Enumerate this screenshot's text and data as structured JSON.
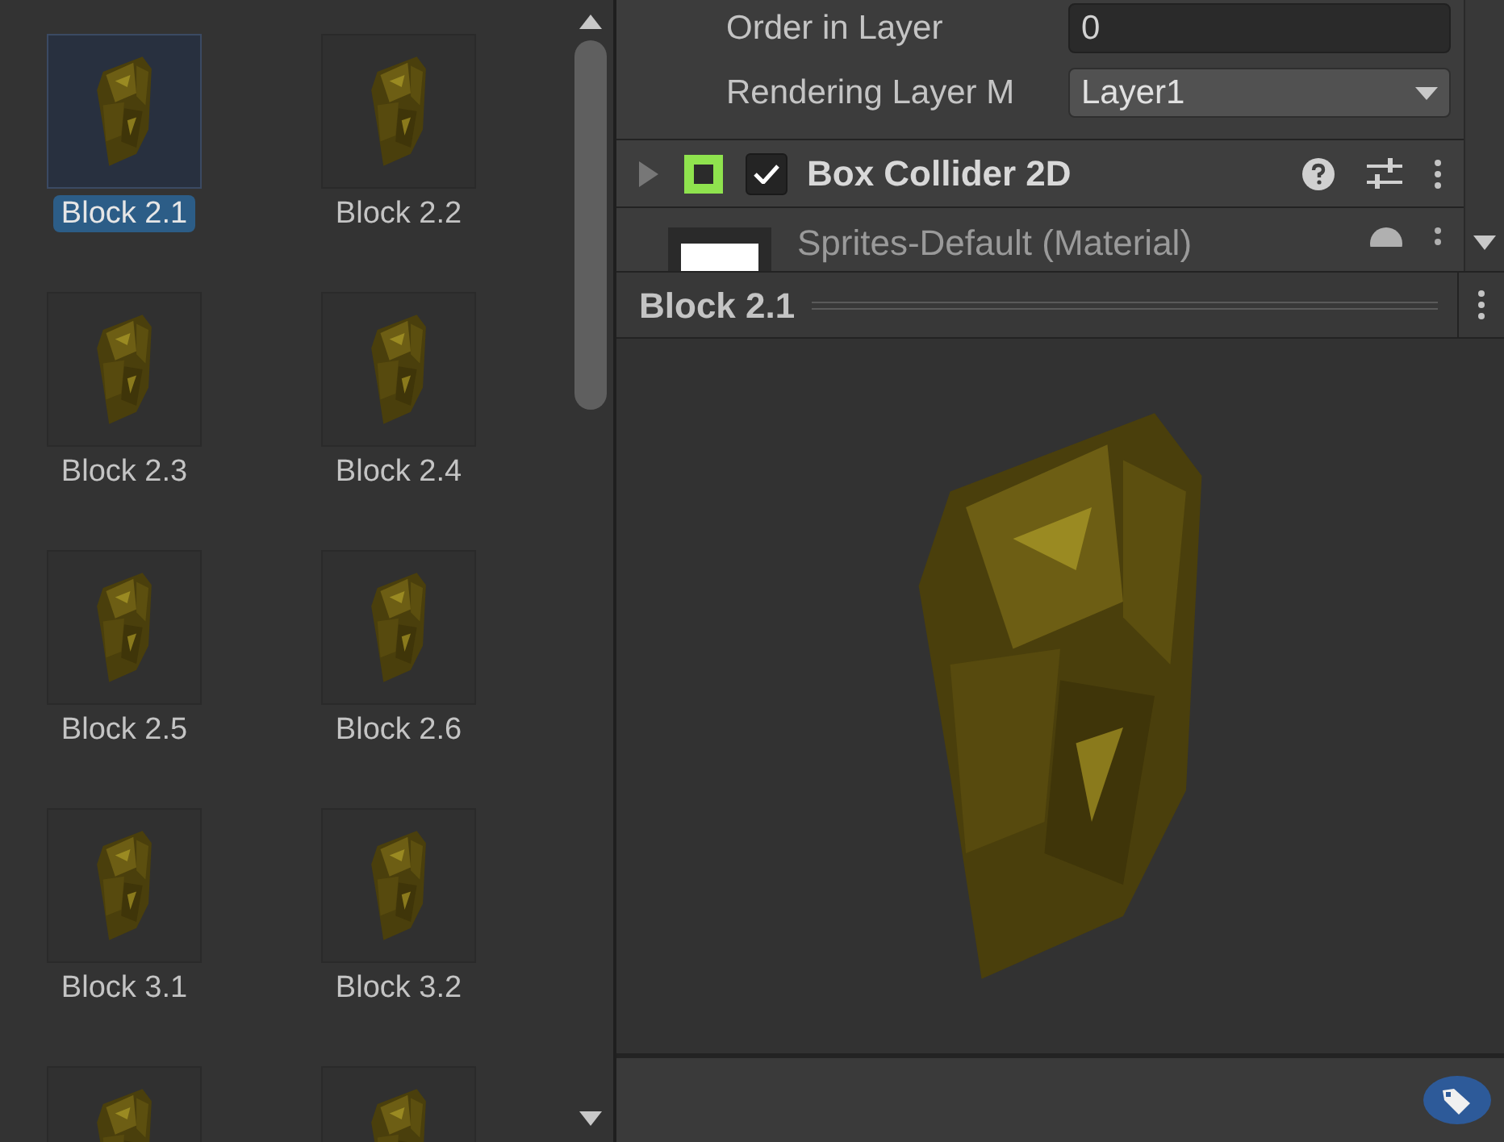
{
  "assets": [
    {
      "label": "Block 2.1",
      "selected": true
    },
    {
      "label": "Block 2.2",
      "selected": false
    },
    {
      "label": "Block 2.3",
      "selected": false
    },
    {
      "label": "Block 2.4",
      "selected": false
    },
    {
      "label": "Block 2.5",
      "selected": false
    },
    {
      "label": "Block 2.6",
      "selected": false
    },
    {
      "label": "Block 3.1",
      "selected": false
    },
    {
      "label": "Block 3.2",
      "selected": false
    },
    {
      "selected": false
    },
    {
      "selected": false
    }
  ],
  "inspector": {
    "fields": [
      {
        "kind": "number",
        "label": "Order in Layer",
        "value": "0"
      },
      {
        "kind": "dropdown",
        "label": "Rendering Layer M",
        "value": "Layer1"
      }
    ],
    "component": {
      "title": "Box Collider 2D",
      "expanded": false,
      "enabled": true
    },
    "material": {
      "name": "Sprites-Default (Material)"
    }
  },
  "preview": {
    "title": "Block 2.1"
  }
}
